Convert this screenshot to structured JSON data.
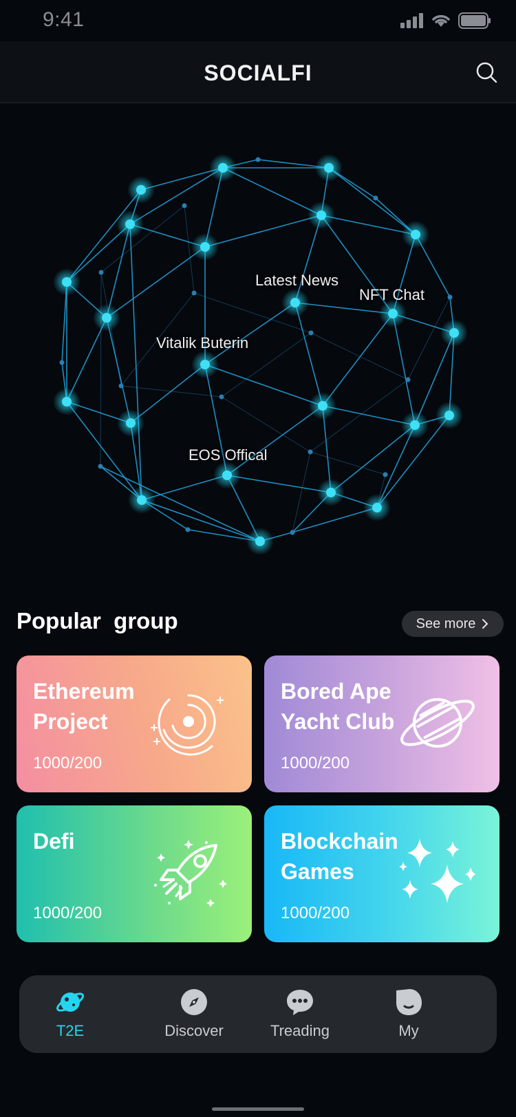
{
  "status": {
    "time": "9:41"
  },
  "header": {
    "title": "SOCIALFI"
  },
  "globe": {
    "labels": {
      "latest_news": "Latest News",
      "nft_chat": "NFT Chat",
      "vitalik": "Vitalik Buterin",
      "eos": "EOS Offical"
    }
  },
  "popular": {
    "title": "Popular  group",
    "see_more": "See more",
    "cards": [
      {
        "title": "Ethereum Project",
        "count": "1000/200",
        "icon": "galaxy-icon"
      },
      {
        "title": "Bored Ape Yacht Club",
        "count": "1000/200",
        "icon": "planet-icon"
      },
      {
        "title": "Defi",
        "count": "1000/200",
        "icon": "rocket-icon"
      },
      {
        "title": "Blockchain Games",
        "count": "1000/200",
        "icon": "sparkles-icon"
      }
    ]
  },
  "tabs": [
    {
      "label": "T2E",
      "icon": "planet-icon",
      "active": true
    },
    {
      "label": "Discover",
      "icon": "compass-icon",
      "active": false
    },
    {
      "label": "Treading",
      "icon": "chat-icon",
      "active": false
    },
    {
      "label": "My",
      "icon": "profile-icon",
      "active": false
    }
  ],
  "colors": {
    "accent": "#22d6f0",
    "node": "#3fe0f5",
    "line": "#1f9fd6",
    "background": "#05080d"
  }
}
